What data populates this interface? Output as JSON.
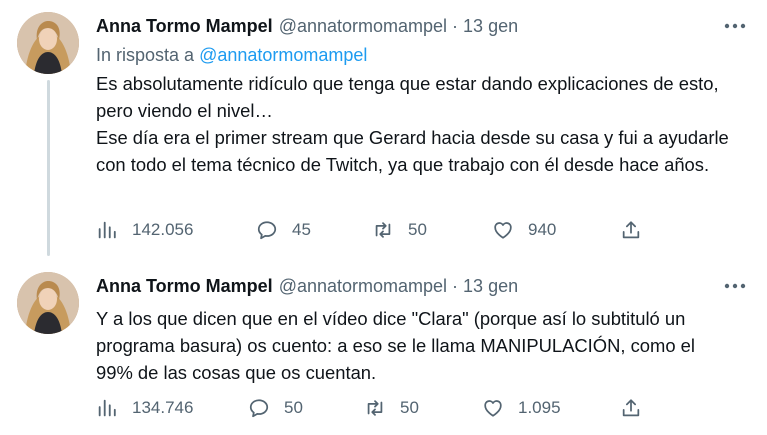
{
  "tweets": [
    {
      "author_name": "Anna Tormo Mampel",
      "handle": "@annatormomampel",
      "separator": "·",
      "time": "13 gen",
      "reply_prefix": "In risposta a ",
      "reply_mention": "@annatormomampel",
      "text": "Es absolutamente ridículo que tenga que estar dando explicaciones de esto, pero viendo el nivel…\nEse día era el primer stream que Gerard hacia desde su casa y fui a ayudarle con todo el tema técnico de Twitch, ya que trabajo con él desde hace años.",
      "views": "142.056",
      "replies": "45",
      "retweets": "50",
      "likes": "940"
    },
    {
      "author_name": "Anna Tormo Mampel",
      "handle": "@annatormomampel",
      "separator": "·",
      "time": "13 gen",
      "text": "Y a los que dicen que en el vídeo dice \"Clara\" (porque así lo subtituló un programa basura) os cuento: a eso se le llama MANIPULACIÓN, como el 99% de las cosas que os cuentan.",
      "views": "134.746",
      "replies": "50",
      "retweets": "50",
      "likes": "1.095"
    }
  ],
  "icons": {
    "views": "views-icon",
    "reply": "reply-icon",
    "retweet": "retweet-icon",
    "like": "heart-icon",
    "share": "share-icon",
    "more": "more-icon"
  },
  "colors": {
    "text": "#0f1419",
    "secondary": "#536471",
    "link": "#1d9bf0",
    "thread_line": "#cfd9de"
  }
}
